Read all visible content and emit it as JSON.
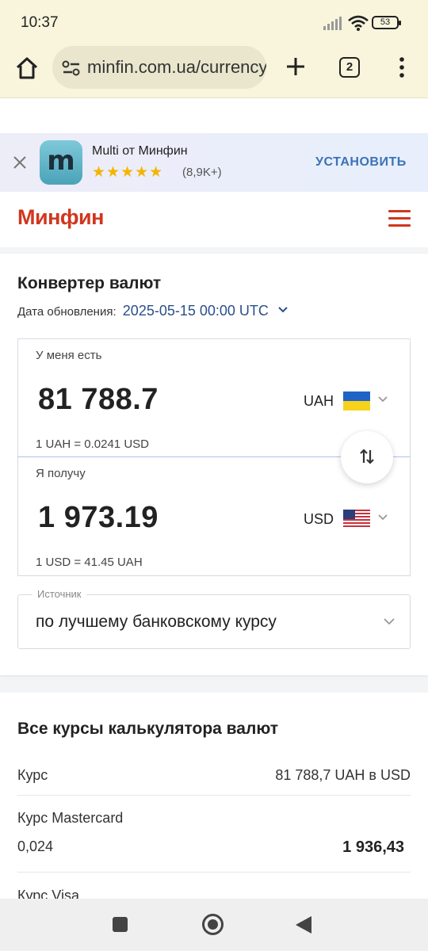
{
  "status_bar": {
    "time": "10:37",
    "battery": "53"
  },
  "browser": {
    "url": "minfin.com.ua/currency/converter",
    "tab_count": "2"
  },
  "app_banner": {
    "app_name": "Multi от Минфин",
    "logo_letter": "m",
    "stars": "★★★★★",
    "rating": "(8,9K+)",
    "install_label": "УСТАНОВИТЬ"
  },
  "site": {
    "logo": "Минфин",
    "accent_color": "#d1361f"
  },
  "converter": {
    "title": "Конвертер валют",
    "update_label": "Дата обновления:",
    "update_date": "2025-05-15 00:00 UTC",
    "have": {
      "label": "У меня есть",
      "amount": "81 788.7",
      "currency": "UAH",
      "rate": "1 UAH = 0.0241 USD"
    },
    "get": {
      "label": "Я получу",
      "amount": "1 973.19",
      "currency": "USD",
      "rate": "1 USD = 41.45 UAH"
    },
    "source": {
      "legend": "Источник",
      "value": "по лучшему банковскому курсу"
    }
  },
  "rates": {
    "title": "Все курсы калькулятора валют",
    "rows": [
      {
        "label": "Курс",
        "value": "81 788,7 UAH в USD"
      },
      {
        "label": "Курс Mastercard",
        "rate": "0,024",
        "total": "1 936,43"
      },
      {
        "label": "Курс Visa"
      }
    ]
  }
}
